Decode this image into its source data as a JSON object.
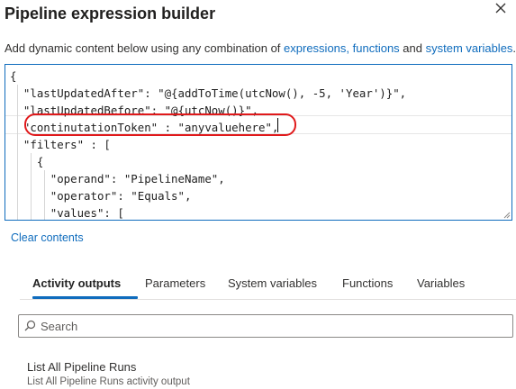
{
  "header": {
    "title": "Pipeline expression builder"
  },
  "description": {
    "prefix": "Add dynamic content below using any combination of ",
    "link_expressions": "expressions,",
    "space": " ",
    "link_functions": "functions",
    "middle": " and ",
    "link_system_variables": "system variables",
    "suffix": "."
  },
  "editor": {
    "lines": [
      "{",
      "  \"lastUpdatedAfter\": \"@{addToTime(utcNow(), -5, 'Year')}\",",
      "  \"lastUpdatedBefore\": \"@{utcNow()}\",",
      "  \"continutationToken\" : \"anyvaluehere\",",
      "  \"filters\" : [",
      "    {",
      "      \"operand\": \"PipelineName\",",
      "      \"operator\": \"Equals\",",
      "      \"values\": ["
    ]
  },
  "clear_contents_label": "Clear contents",
  "tabs": [
    {
      "label": "Activity outputs",
      "active": true
    },
    {
      "label": "Parameters",
      "active": false
    },
    {
      "label": "System variables",
      "active": false
    },
    {
      "label": "Functions",
      "active": false
    },
    {
      "label": "Variables",
      "active": false
    }
  ],
  "search": {
    "placeholder": "Search",
    "value": ""
  },
  "results": [
    {
      "title": "List All Pipeline Runs",
      "subtitle": "List All Pipeline Runs activity output"
    }
  ],
  "colors": {
    "accent": "#0f6cbd",
    "annotation": "#e0191b",
    "string": "#a31515"
  }
}
